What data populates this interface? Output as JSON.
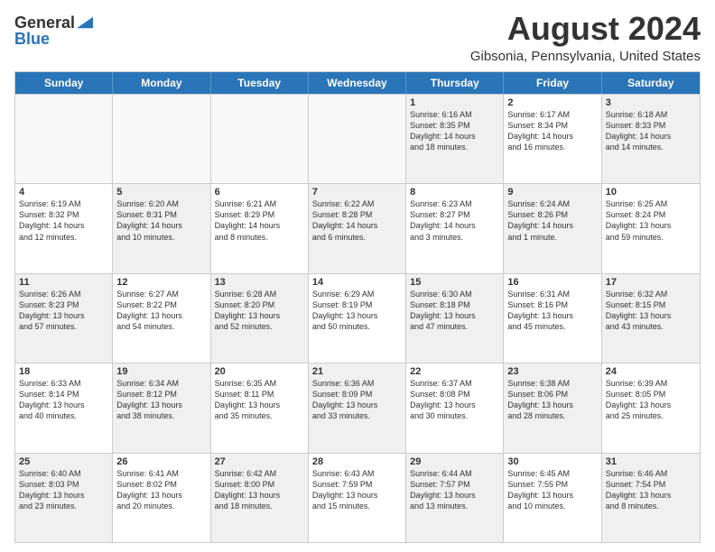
{
  "logo": {
    "general": "General",
    "blue": "Blue"
  },
  "header": {
    "month": "August 2024",
    "location": "Gibsonia, Pennsylvania, United States"
  },
  "days": [
    "Sunday",
    "Monday",
    "Tuesday",
    "Wednesday",
    "Thursday",
    "Friday",
    "Saturday"
  ],
  "rows": [
    [
      {
        "day": "",
        "lines": [],
        "empty": true
      },
      {
        "day": "",
        "lines": [],
        "empty": true
      },
      {
        "day": "",
        "lines": [],
        "empty": true
      },
      {
        "day": "",
        "lines": [],
        "empty": true
      },
      {
        "day": "1",
        "lines": [
          "Sunrise: 6:16 AM",
          "Sunset: 8:35 PM",
          "Daylight: 14 hours",
          "and 18 minutes."
        ],
        "shaded": true
      },
      {
        "day": "2",
        "lines": [
          "Sunrise: 6:17 AM",
          "Sunset: 8:34 PM",
          "Daylight: 14 hours",
          "and 16 minutes."
        ],
        "shaded": false
      },
      {
        "day": "3",
        "lines": [
          "Sunrise: 6:18 AM",
          "Sunset: 8:33 PM",
          "Daylight: 14 hours",
          "and 14 minutes."
        ],
        "shaded": true
      }
    ],
    [
      {
        "day": "4",
        "lines": [
          "Sunrise: 6:19 AM",
          "Sunset: 8:32 PM",
          "Daylight: 14 hours",
          "and 12 minutes."
        ],
        "shaded": false
      },
      {
        "day": "5",
        "lines": [
          "Sunrise: 6:20 AM",
          "Sunset: 8:31 PM",
          "Daylight: 14 hours",
          "and 10 minutes."
        ],
        "shaded": true
      },
      {
        "day": "6",
        "lines": [
          "Sunrise: 6:21 AM",
          "Sunset: 8:29 PM",
          "Daylight: 14 hours",
          "and 8 minutes."
        ],
        "shaded": false
      },
      {
        "day": "7",
        "lines": [
          "Sunrise: 6:22 AM",
          "Sunset: 8:28 PM",
          "Daylight: 14 hours",
          "and 6 minutes."
        ],
        "shaded": true
      },
      {
        "day": "8",
        "lines": [
          "Sunrise: 6:23 AM",
          "Sunset: 8:27 PM",
          "Daylight: 14 hours",
          "and 3 minutes."
        ],
        "shaded": false
      },
      {
        "day": "9",
        "lines": [
          "Sunrise: 6:24 AM",
          "Sunset: 8:26 PM",
          "Daylight: 14 hours",
          "and 1 minute."
        ],
        "shaded": true
      },
      {
        "day": "10",
        "lines": [
          "Sunrise: 6:25 AM",
          "Sunset: 8:24 PM",
          "Daylight: 13 hours",
          "and 59 minutes."
        ],
        "shaded": false
      }
    ],
    [
      {
        "day": "11",
        "lines": [
          "Sunrise: 6:26 AM",
          "Sunset: 8:23 PM",
          "Daylight: 13 hours",
          "and 57 minutes."
        ],
        "shaded": true
      },
      {
        "day": "12",
        "lines": [
          "Sunrise: 6:27 AM",
          "Sunset: 8:22 PM",
          "Daylight: 13 hours",
          "and 54 minutes."
        ],
        "shaded": false
      },
      {
        "day": "13",
        "lines": [
          "Sunrise: 6:28 AM",
          "Sunset: 8:20 PM",
          "Daylight: 13 hours",
          "and 52 minutes."
        ],
        "shaded": true
      },
      {
        "day": "14",
        "lines": [
          "Sunrise: 6:29 AM",
          "Sunset: 8:19 PM",
          "Daylight: 13 hours",
          "and 50 minutes."
        ],
        "shaded": false
      },
      {
        "day": "15",
        "lines": [
          "Sunrise: 6:30 AM",
          "Sunset: 8:18 PM",
          "Daylight: 13 hours",
          "and 47 minutes."
        ],
        "shaded": true
      },
      {
        "day": "16",
        "lines": [
          "Sunrise: 6:31 AM",
          "Sunset: 8:16 PM",
          "Daylight: 13 hours",
          "and 45 minutes."
        ],
        "shaded": false
      },
      {
        "day": "17",
        "lines": [
          "Sunrise: 6:32 AM",
          "Sunset: 8:15 PM",
          "Daylight: 13 hours",
          "and 43 minutes."
        ],
        "shaded": true
      }
    ],
    [
      {
        "day": "18",
        "lines": [
          "Sunrise: 6:33 AM",
          "Sunset: 8:14 PM",
          "Daylight: 13 hours",
          "and 40 minutes."
        ],
        "shaded": false
      },
      {
        "day": "19",
        "lines": [
          "Sunrise: 6:34 AM",
          "Sunset: 8:12 PM",
          "Daylight: 13 hours",
          "and 38 minutes."
        ],
        "shaded": true
      },
      {
        "day": "20",
        "lines": [
          "Sunrise: 6:35 AM",
          "Sunset: 8:11 PM",
          "Daylight: 13 hours",
          "and 35 minutes."
        ],
        "shaded": false
      },
      {
        "day": "21",
        "lines": [
          "Sunrise: 6:36 AM",
          "Sunset: 8:09 PM",
          "Daylight: 13 hours",
          "and 33 minutes."
        ],
        "shaded": true
      },
      {
        "day": "22",
        "lines": [
          "Sunrise: 6:37 AM",
          "Sunset: 8:08 PM",
          "Daylight: 13 hours",
          "and 30 minutes."
        ],
        "shaded": false
      },
      {
        "day": "23",
        "lines": [
          "Sunrise: 6:38 AM",
          "Sunset: 8:06 PM",
          "Daylight: 13 hours",
          "and 28 minutes."
        ],
        "shaded": true
      },
      {
        "day": "24",
        "lines": [
          "Sunrise: 6:39 AM",
          "Sunset: 8:05 PM",
          "Daylight: 13 hours",
          "and 25 minutes."
        ],
        "shaded": false
      }
    ],
    [
      {
        "day": "25",
        "lines": [
          "Sunrise: 6:40 AM",
          "Sunset: 8:03 PM",
          "Daylight: 13 hours",
          "and 23 minutes."
        ],
        "shaded": true
      },
      {
        "day": "26",
        "lines": [
          "Sunrise: 6:41 AM",
          "Sunset: 8:02 PM",
          "Daylight: 13 hours",
          "and 20 minutes."
        ],
        "shaded": false
      },
      {
        "day": "27",
        "lines": [
          "Sunrise: 6:42 AM",
          "Sunset: 8:00 PM",
          "Daylight: 13 hours",
          "and 18 minutes."
        ],
        "shaded": true
      },
      {
        "day": "28",
        "lines": [
          "Sunrise: 6:43 AM",
          "Sunset: 7:59 PM",
          "Daylight: 13 hours",
          "and 15 minutes."
        ],
        "shaded": false
      },
      {
        "day": "29",
        "lines": [
          "Sunrise: 6:44 AM",
          "Sunset: 7:57 PM",
          "Daylight: 13 hours",
          "and 13 minutes."
        ],
        "shaded": true
      },
      {
        "day": "30",
        "lines": [
          "Sunrise: 6:45 AM",
          "Sunset: 7:55 PM",
          "Daylight: 13 hours",
          "and 10 minutes."
        ],
        "shaded": false
      },
      {
        "day": "31",
        "lines": [
          "Sunrise: 6:46 AM",
          "Sunset: 7:54 PM",
          "Daylight: 13 hours",
          "and 8 minutes."
        ],
        "shaded": true
      }
    ]
  ]
}
